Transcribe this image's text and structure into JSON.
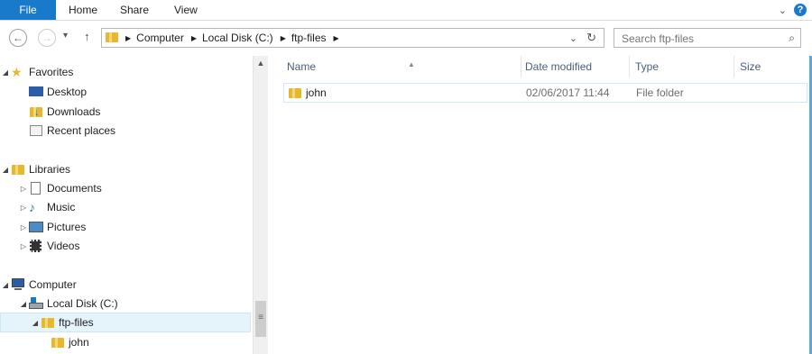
{
  "ribbon": {
    "file": "File",
    "tabs": [
      "Home",
      "Share",
      "View"
    ],
    "chevron": "⌄",
    "help": "?"
  },
  "nav": {
    "back": "←",
    "forward": "→",
    "recent": "▾",
    "up": "↑",
    "breadcrumbs": [
      "Computer",
      "Local Disk (C:)",
      "ftp-files"
    ],
    "refresh": "↻",
    "dropdown": "⌄",
    "search_placeholder": "Search ftp-files"
  },
  "sidebar": {
    "favorites": {
      "label": "Favorites",
      "items": [
        "Desktop",
        "Downloads",
        "Recent places"
      ]
    },
    "libraries": {
      "label": "Libraries",
      "items": [
        "Documents",
        "Music",
        "Pictures",
        "Videos"
      ]
    },
    "computer": {
      "label": "Computer",
      "disk": "Local Disk (C:)",
      "folder": "ftp-files",
      "sub": "john"
    }
  },
  "columns": [
    "Name",
    "Date modified",
    "Type",
    "Size"
  ],
  "files": [
    {
      "name": "john",
      "date": "02/06/2017 11:44",
      "type": "File folder",
      "size": ""
    }
  ],
  "colors": {
    "accent": "#1979ca",
    "selection": "#e5f3fb",
    "folder": "#e8b730"
  }
}
